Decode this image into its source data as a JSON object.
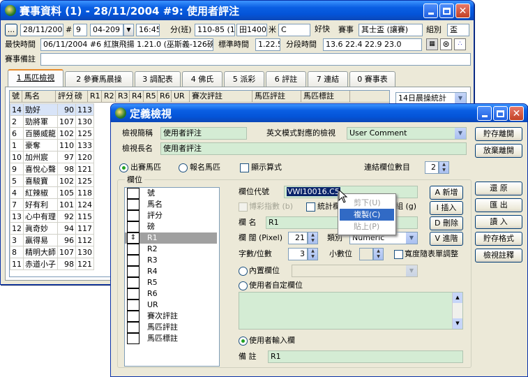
{
  "main": {
    "title": "賽事資料 (1) - 28/11/2004 #9: 使用者評注",
    "row1": {
      "dots": "...",
      "date": "28/11/2004",
      "hash": "#",
      "race_no": "9",
      "code": "04-209",
      "time": "16:45",
      "fen_lbl": "分(班)",
      "rating": "110-85 (1)",
      "dist": "田1400",
      "mi_lbl": "米",
      "course": "C",
      "going": "好快",
      "saishi_lbl": "賽事",
      "cup": "其士盃 (讓賽)",
      "group_lbl": "組別",
      "group": "盃"
    },
    "row2": {
      "best_lbl": "最快時間",
      "best": "06/11/2004 #6 紅旗飛揚 1.21.0 (巫斯義-126磅)",
      "std_lbl": "標準時間",
      "std": "1.22.5",
      "split_lbl": "分段時間",
      "split": "13.6 22.4 22.9 23.0"
    },
    "row3": {
      "note_lbl": "賽事備註",
      "note": ""
    },
    "tabs": [
      "1 馬匹檢視",
      "2 參賽馬晨操",
      "3 調配表",
      "4 佛氏",
      "5 派彩",
      "6 評註",
      "7 連結",
      "0 賽事表"
    ],
    "grid_headers": [
      "號",
      "馬名",
      "評分",
      "磅",
      "R1",
      "R2",
      "R3",
      "R4",
      "R5",
      "R6",
      "UR",
      "賽次評註",
      "馬匹評註",
      "馬匹標註"
    ],
    "stats_combo": "14日晨操統計",
    "rows": [
      {
        "no": "14",
        "name": "勁好",
        "rating": "90",
        "wt": "113"
      },
      {
        "no": "2",
        "name": "勁將軍",
        "rating": "107",
        "wt": "130"
      },
      {
        "no": "6",
        "name": "百勝威龍",
        "rating": "102",
        "wt": "125"
      },
      {
        "no": "1",
        "name": "豪奪",
        "rating": "110",
        "wt": "133"
      },
      {
        "no": "10",
        "name": "加州宸",
        "rating": "97",
        "wt": "120"
      },
      {
        "no": "9",
        "name": "喜悅心聲",
        "rating": "98",
        "wt": "121"
      },
      {
        "no": "5",
        "name": "喜駿寶",
        "rating": "102",
        "wt": "125"
      },
      {
        "no": "4",
        "name": "紅辣椒",
        "rating": "105",
        "wt": "118"
      },
      {
        "no": "7",
        "name": "好有利",
        "rating": "101",
        "wt": "124"
      },
      {
        "no": "13",
        "name": "心中有理",
        "rating": "92",
        "wt": "115"
      },
      {
        "no": "12",
        "name": "眞奇妙",
        "rating": "94",
        "wt": "117"
      },
      {
        "no": "3",
        "name": "贏得易",
        "rating": "96",
        "wt": "112"
      },
      {
        "no": "8",
        "name": "精明大師",
        "rating": "107",
        "wt": "130"
      },
      {
        "no": "11",
        "name": "赤道小子",
        "rating": "98",
        "wt": "121"
      }
    ]
  },
  "dialog": {
    "title": "定義檢視",
    "brief_lbl": "檢視簡稱",
    "brief": "使用者評注",
    "eng_lbl": "英文模式對應的檢視",
    "eng": "User Comment",
    "long_lbl": "檢視長名",
    "long": "使用者評注",
    "radio_runners": "出賽馬匹",
    "radio_entries": "報名馬匹",
    "show_formula": "顯示算式",
    "link_count_lbl": "連結欄位數目",
    "link_count": "2",
    "fields_group": "欄位",
    "field_list": [
      "號",
      "馬名",
      "評分",
      "磅",
      "R1",
      "R2",
      "R3",
      "R4",
      "R5",
      "R6",
      "UR",
      "賽次評註",
      "馬匹評註",
      "馬匹標註"
    ],
    "code_lbl": "欄位代號",
    "code": "VWI10016.C5",
    "odds_lbl": "博彩指數 (b)",
    "stats_lbl": "統計欄",
    "group_g": "組 (g)",
    "name_lbl": "欄 名",
    "name": "R1",
    "width_lbl": "欄 闊 (Pixel)",
    "width": "21",
    "type_lbl": "類別",
    "type": "Numeric",
    "digits_lbl": "字數/位數",
    "digits": "3",
    "dec_lbl": "小數位",
    "dec": "",
    "autowidth": "寬度隨表單調整",
    "builtin": "內置欄位",
    "userdef": "使用者自定欄位",
    "userinput": "使用者輸入欄",
    "remark_lbl": "備 註",
    "remark": "R1",
    "side_btns": {
      "new": "A 新增",
      "insert": "I 插入",
      "delete": "D 刪除",
      "advance": "V 進階"
    },
    "right_btns": {
      "save_exit": "貯存離開",
      "discard": "放棄離開",
      "restore": "還 原",
      "export": "匯 出",
      "import": "讀 入",
      "save_fmt": "貯存格式",
      "view_notes": "檢視註釋"
    },
    "menu": [
      "剪下(U)",
      "複製(C)",
      "貼上(P)"
    ]
  }
}
